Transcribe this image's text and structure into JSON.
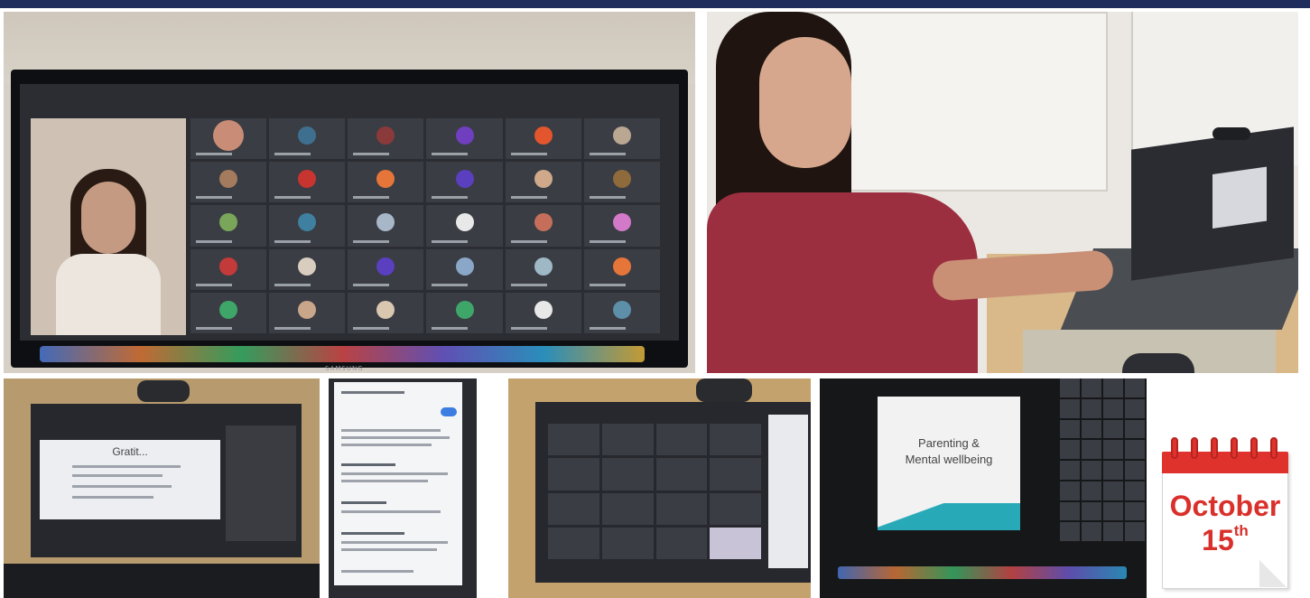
{
  "photos": {
    "remote_session_monitor": {
      "brand": "SAMSUNG"
    },
    "facilitator_at_laptop": {},
    "laptop_slide": {
      "slide_title": "Gratit..."
    },
    "phone_chat": {},
    "laptop_gallery": {},
    "laptop_presentation": {
      "slide_title_line1": "Parenting &",
      "slide_title_line2": "Mental wellbeing"
    }
  },
  "calendar": {
    "month": "October",
    "day": "15",
    "suffix": "th"
  },
  "colors": {
    "top_bar": "#1f2d5c",
    "calendar_red": "#d9302b"
  }
}
